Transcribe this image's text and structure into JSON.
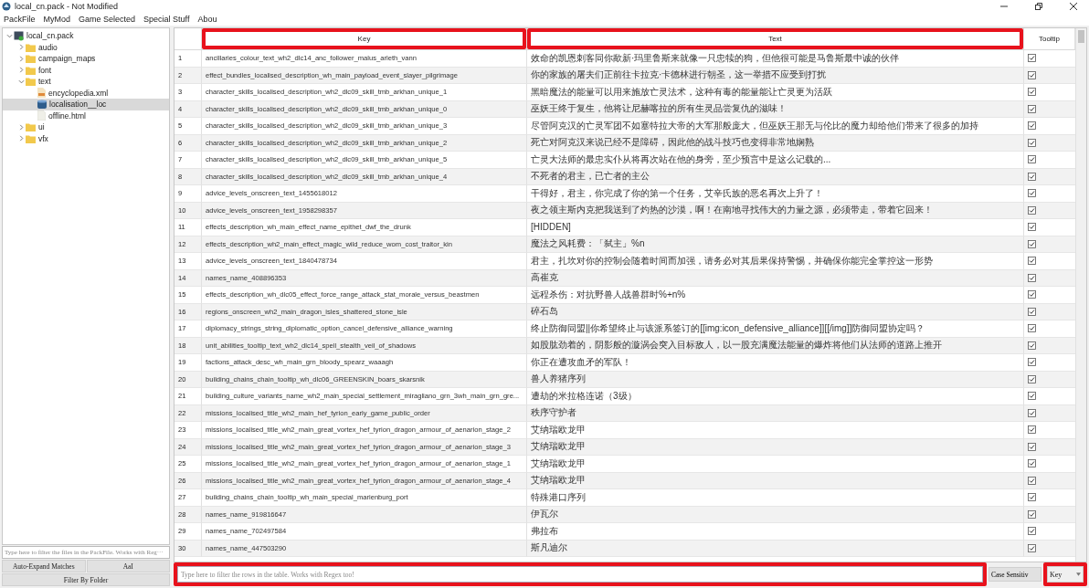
{
  "window": {
    "title": "local_cn.pack - Not Modified"
  },
  "menu": [
    "PackFile",
    "MyMod",
    "Game Selected",
    "Special Stuff",
    "Abou"
  ],
  "tree": [
    {
      "label": "local_cn.pack",
      "kind": "pack",
      "expanded": true,
      "selected": false,
      "children": [
        {
          "label": "audio",
          "kind": "folder",
          "expanded": false,
          "selected": false
        },
        {
          "label": "campaign_maps",
          "kind": "folder",
          "expanded": false,
          "selected": false
        },
        {
          "label": "font",
          "kind": "folder",
          "expanded": false,
          "selected": false
        },
        {
          "label": "text",
          "kind": "folder",
          "expanded": true,
          "selected": false,
          "children": [
            {
              "label": "encyclopedia.xml",
              "kind": "xml",
              "selected": false
            },
            {
              "label": "localisation__loc",
              "kind": "table",
              "selected": true
            },
            {
              "label": "offline.html",
              "kind": "page",
              "selected": false
            }
          ]
        },
        {
          "label": "ui",
          "kind": "folder",
          "expanded": false,
          "selected": false
        },
        {
          "label": "vfx",
          "kind": "folder",
          "expanded": false,
          "selected": false
        }
      ]
    }
  ],
  "file_filter": {
    "placeholder": "Type here to filter the files in the PackFile. Works with Reg···"
  },
  "file_buttons": [
    "Auto-Expand Matches",
    "AaI"
  ],
  "folder_button": "Filter By Folder",
  "table": {
    "columns": [
      {
        "label": "Key",
        "highlighted": true
      },
      {
        "label": "Text",
        "highlighted": true
      },
      {
        "label": "Tooltip",
        "highlighted": false
      }
    ],
    "rows": [
      {
        "index": "1",
        "key": "ancillaries_colour_text_wh2_dlc14_anc_follower_malus_arleth_vann",
        "text": "效命的凯恩刺客同你歃新·玛里鲁斯来就像一只忠犊的狗，但他很可能是马鲁斯最中诚的伙伴",
        "tooltip": true
      },
      {
        "index": "2",
        "key": "effect_bundles_localised_description_wh_main_payload_event_slayer_pilgrimage",
        "text": "你的家族的屠夫们正前往卡拉克·卡德林进行朝圣，这一举措不应受到打扰",
        "tooltip": true
      },
      {
        "index": "3",
        "key": "character_skills_localised_description_wh2_dlc09_skill_tmb_arkhan_unique_1",
        "text": "黑暗魔法的能量可以用来施放亡灵法术，这种有毒的能量能让亡灵更为活跃",
        "tooltip": true
      },
      {
        "index": "4",
        "key": "character_skills_localised_description_wh2_dlc09_skill_tmb_arkhan_unique_0",
        "text": "巫妖王终于复生，他将让尼赫喀拉的所有生灵品尝复仇的滋味！",
        "tooltip": true
      },
      {
        "index": "5",
        "key": "character_skills_localised_description_wh2_dlc09_skill_tmb_arkhan_unique_3",
        "text": "尽管阿克汉的亡灵军团不如塞特拉大帝的大军那般庞大，但巫妖王那无与伦比的魔力却给他们带来了很多的加持",
        "tooltip": true
      },
      {
        "index": "6",
        "key": "character_skills_localised_description_wh2_dlc09_skill_tmb_arkhan_unique_2",
        "text": "死亡对阿克汉来说已经不是障碍，因此他的战斗技巧也变得非常地娴熟",
        "tooltip": true
      },
      {
        "index": "7",
        "key": "character_skills_localised_description_wh2_dlc09_skill_tmb_arkhan_unique_5",
        "text": "亡灵大法师的最忠实仆从将再次站在他的身旁，至少预言中是这么记载的...",
        "tooltip": true
      },
      {
        "index": "8",
        "key": "character_skills_localised_description_wh2_dlc09_skill_tmb_arkhan_unique_4",
        "text": "不死者的君主，已亡者的主公",
        "tooltip": true
      },
      {
        "index": "9",
        "key": "advice_levels_onscreen_text_1455618012",
        "text": "干得好，君主，你完成了你的第一个任务，艾辛氏族的恶名再次上升了！",
        "tooltip": true
      },
      {
        "index": "10",
        "key": "advice_levels_onscreen_text_1958298357",
        "text": "夜之领主斯内克把我送到了灼热的沙漠，啊！在南地寻找伟大的力量之源，必须带走，带着它回来！",
        "tooltip": true
      },
      {
        "index": "11",
        "key": "effects_description_wh_main_effect_name_epithet_dwf_the_drunk",
        "text": "[HIDDEN]",
        "tooltip": true
      },
      {
        "index": "12",
        "key": "effects_description_wh2_main_effect_magic_wild_reduce_wom_cost_traitor_kin",
        "text": "魔法之风耗费：「弑主」%n",
        "tooltip": true
      },
      {
        "index": "13",
        "key": "advice_levels_onscreen_text_1840478734",
        "text": "君主，扎坎对你的控制会随着时间而加强，请务必对其后果保持警惕，并确保你能完全掌控这一形势",
        "tooltip": true
      },
      {
        "index": "14",
        "key": "names_name_408896353",
        "text": "高崔克",
        "tooltip": true
      },
      {
        "index": "15",
        "key": "effects_description_wh_dlc05_effect_force_range_attack_stat_morale_versus_beastmen",
        "text": "远程杀伤：对抗野兽人战兽群时%+n%",
        "tooltip": true
      },
      {
        "index": "16",
        "key": "regions_onscreen_wh2_main_dragon_isles_shattered_stone_isle",
        "text": "碎石岛",
        "tooltip": true
      },
      {
        "index": "17",
        "key": "diplomacy_strings_string_diplomatic_option_cancel_defensive_alliance_warning",
        "text": "终止防御同盟||你希望终止与该派系签订的[[img:icon_defensive_alliance]][[/img]]防御同盟协定吗？",
        "tooltip": true
      },
      {
        "index": "18",
        "key": "unit_abilities_tooltip_text_wh2_dlc14_spell_stealth_veil_of_shadows",
        "text": "如股肱劲着的，阴影般的漩涡会突入目标敌人，以一股充满魔法能量的爆炸将他们从法师的道路上推开",
        "tooltip": true
      },
      {
        "index": "19",
        "key": "factions_attack_desc_wh_main_grn_bloody_spearz_waaagh",
        "text": "你正在遭攻血矛的军队！",
        "tooltip": true
      },
      {
        "index": "20",
        "key": "building_chains_chain_tooltip_wh_dlc06_GREENSKIN_boars_skarsnik",
        "text": "兽人养猪序列",
        "tooltip": true
      },
      {
        "index": "21",
        "key": "building_culture_variants_name_wh2_main_special_settlement_miragliano_grn_3wh_main_grn_gre...",
        "text": "遭劫的米拉格连诺（3级）",
        "tooltip": true
      },
      {
        "index": "22",
        "key": "missions_localised_title_wh2_main_hef_tyrion_early_game_public_order",
        "text": "秩序守护者",
        "tooltip": true
      },
      {
        "index": "23",
        "key": "missions_localised_title_wh2_main_great_vortex_hef_tyrion_dragon_armour_of_aenarion_stage_2",
        "text": "艾纳瑞欧龙甲",
        "tooltip": true
      },
      {
        "index": "24",
        "key": "missions_localised_title_wh2_main_great_vortex_hef_tyrion_dragon_armour_of_aenarion_stage_3",
        "text": "艾纳瑞欧龙甲",
        "tooltip": true
      },
      {
        "index": "25",
        "key": "missions_localised_title_wh2_main_great_vortex_hef_tyrion_dragon_armour_of_aenarion_stage_1",
        "text": "艾纳瑞欧龙甲",
        "tooltip": true
      },
      {
        "index": "26",
        "key": "missions_localised_title_wh2_main_great_vortex_hef_tyrion_dragon_armour_of_aenarion_stage_4",
        "text": "艾纳瑞欧龙甲",
        "tooltip": true
      },
      {
        "index": "27",
        "key": "building_chains_chain_tooltip_wh_main_special_marienburg_port",
        "text": "特殊港口序列",
        "tooltip": true
      },
      {
        "index": "28",
        "key": "names_name_919816647",
        "text": "伊瓦尔",
        "tooltip": true
      },
      {
        "index": "29",
        "key": "names_name_702497584",
        "text": "弗拉布",
        "tooltip": true
      },
      {
        "index": "30",
        "key": "names_name_447503290",
        "text": "斯凡迪尔",
        "tooltip": true
      }
    ]
  },
  "row_filter": {
    "placeholder": "Type here to filter the rows in the table. Works with Regex too!",
    "highlighted": true
  },
  "case_button": "Case Sensitiv",
  "column_select": {
    "value": "Key",
    "highlighted": true
  }
}
